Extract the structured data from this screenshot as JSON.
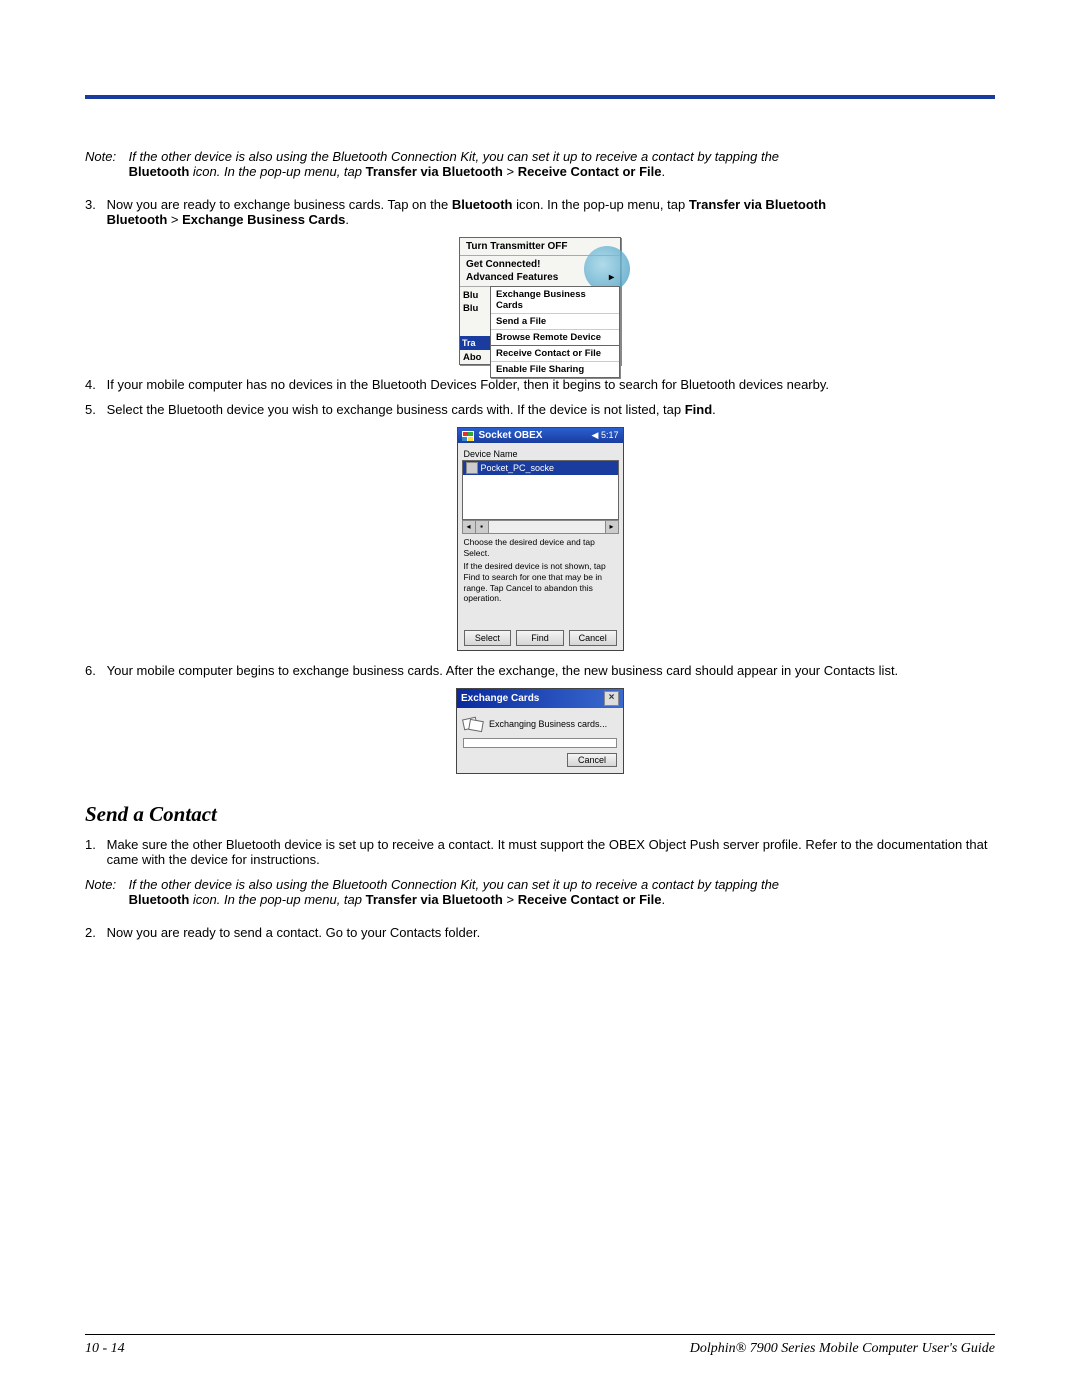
{
  "note1": {
    "label": "Note:",
    "line1": "If the other device is also using the Bluetooth Connection Kit, you can set it up to receive a contact by tapping the",
    "sub_bt": "Bluetooth",
    "sub_mid": " icon. In the pop-up menu, tap ",
    "sub_tvb": "Transfer via Bluetooth",
    "sub_gt": " > ",
    "sub_rcof": "Receive Contact or File",
    "sub_end": "."
  },
  "step3": {
    "num": "3.",
    "t1": "Now you are ready to exchange business cards. Tap on the ",
    "bt": "Bluetooth",
    "t2": " icon. In the pop-up menu, tap ",
    "tvb": "Transfer via Bluetooth",
    "gt": " > ",
    "ebc": "Exchange Business Cards",
    "end": "."
  },
  "menu": {
    "turn_off": "Turn Transmitter OFF",
    "get_connected": "Get Connected!",
    "advanced": "Advanced Features",
    "arrow": "▸",
    "left1": "Blu",
    "left2": "Blu",
    "tra": "Tra",
    "abo": "Abo",
    "sub": {
      "ebc": "Exchange Business Cards",
      "send_file": "Send a File",
      "browse": "Browse Remote Device",
      "receive": "Receive Contact or File",
      "enable": "Enable File Sharing"
    }
  },
  "step4": {
    "num": "4.",
    "text": "If your mobile computer has no devices in the Bluetooth Devices Folder, then it begins to search for Bluetooth devices nearby."
  },
  "step5": {
    "num": "5.",
    "t1": "Select the Bluetooth device you wish to exchange business cards with. If the device is not listed, tap ",
    "find": "Find",
    "end": "."
  },
  "socket": {
    "title": "Socket OBEX",
    "sound_icon": "◀",
    "time": "5:17",
    "device_name": "Device Name",
    "device": "Pocket_PC_socke",
    "scroll_left": "◂",
    "scroll_thumb": "▪",
    "scroll_right": "▸",
    "instr1": "Choose the desired device and tap Select.",
    "instr2": "If the desired device is not shown, tap Find to search for one that may be in range. Tap Cancel to abandon this operation.",
    "btn_select": "Select",
    "btn_find": "Find",
    "btn_cancel": "Cancel"
  },
  "step6": {
    "num": "6.",
    "text": "Your mobile computer begins to exchange business cards. After the exchange, the new business card should appear in your Contacts list."
  },
  "dlg": {
    "title": "Exchange Cards",
    "close": "×",
    "msg": "Exchanging Business cards...",
    "cancel": "Cancel"
  },
  "section": "Send a Contact",
  "step_s1": {
    "num": "1.",
    "text": "Make sure the other Bluetooth device is set up to receive a contact. It must support the OBEX Object Push server profile. Refer to the documentation that came with the device for instructions."
  },
  "note2": {
    "label": "Note:",
    "line1": "If the other device is also using the Bluetooth Connection Kit, you can set it up to receive a contact by tapping the",
    "sub_bt": "Bluetooth",
    "sub_mid": " icon. In the pop-up menu, tap ",
    "sub_tvb": "Transfer via Bluetooth",
    "sub_gt": " > ",
    "sub_rcof": "Receive Contact or File",
    "sub_end": "."
  },
  "step_s2": {
    "num": "2.",
    "text": "Now you are ready to send a contact. Go to your Contacts folder."
  },
  "footer": {
    "page": "10 - 14",
    "title": "Dolphin® 7900 Series Mobile Computer User's Guide"
  }
}
